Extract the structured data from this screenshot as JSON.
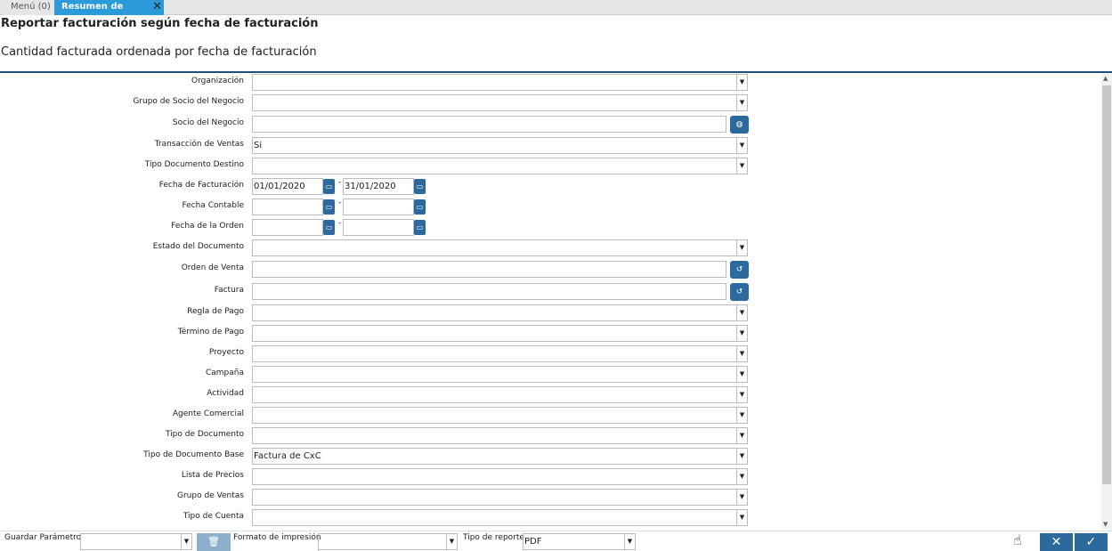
{
  "tabs": [
    {
      "label": "Menú (0)"
    },
    {
      "label": "Resumen de Facturas"
    }
  ],
  "title": "Reportar facturación según fecha de facturación",
  "description": "Cantidad facturada ordenada por fecha de facturación",
  "fields": {
    "organizacion": {
      "label": "Organización",
      "value": ""
    },
    "grupo_socio": {
      "label": "Grupo de Socio del Negocio",
      "value": ""
    },
    "socio": {
      "label": "Socio del Negocio",
      "value": ""
    },
    "transaccion": {
      "label": "Transacción de Ventas",
      "value": "Si"
    },
    "tipo_doc_destino": {
      "label": "Tipo Documento Destino",
      "value": ""
    },
    "fecha_facturacion": {
      "label": "Fecha de Facturación",
      "from": "01/01/2020",
      "to": "31/01/2020"
    },
    "fecha_contable": {
      "label": "Fecha Contable",
      "from": "",
      "to": ""
    },
    "fecha_orden": {
      "label": "Fecha de la Orden",
      "from": "",
      "to": ""
    },
    "estado": {
      "label": "Estado del Documento",
      "value": ""
    },
    "orden_venta": {
      "label": "Orden de Venta",
      "value": ""
    },
    "factura": {
      "label": "Factura",
      "value": ""
    },
    "regla_pago": {
      "label": "Regla de Pago",
      "value": ""
    },
    "termino_pago": {
      "label": "Término de Pago",
      "value": ""
    },
    "proyecto": {
      "label": "Proyecto",
      "value": ""
    },
    "campana": {
      "label": "Campaña",
      "value": ""
    },
    "actividad": {
      "label": "Actividad",
      "value": ""
    },
    "agente": {
      "label": "Agente Comercial",
      "value": ""
    },
    "tipo_documento": {
      "label": "Tipo de Documento",
      "value": ""
    },
    "tipo_doc_base": {
      "label": "Tipo de Documento Base",
      "value": "Factura de CxC"
    },
    "lista_precios": {
      "label": "Lista de Precios",
      "value": ""
    },
    "grupo_ventas": {
      "label": "Grupo de Ventas",
      "value": ""
    },
    "tipo_cuenta": {
      "label": "Tipo de Cuenta",
      "value": ""
    }
  },
  "bottom": {
    "guardar_label": "Guardar Parámetro",
    "guardar_value": "",
    "formato_label": "Formato de impresión",
    "formato_value": "",
    "tipo_label": "Tipo de reporte",
    "tipo_value": "PDF"
  }
}
